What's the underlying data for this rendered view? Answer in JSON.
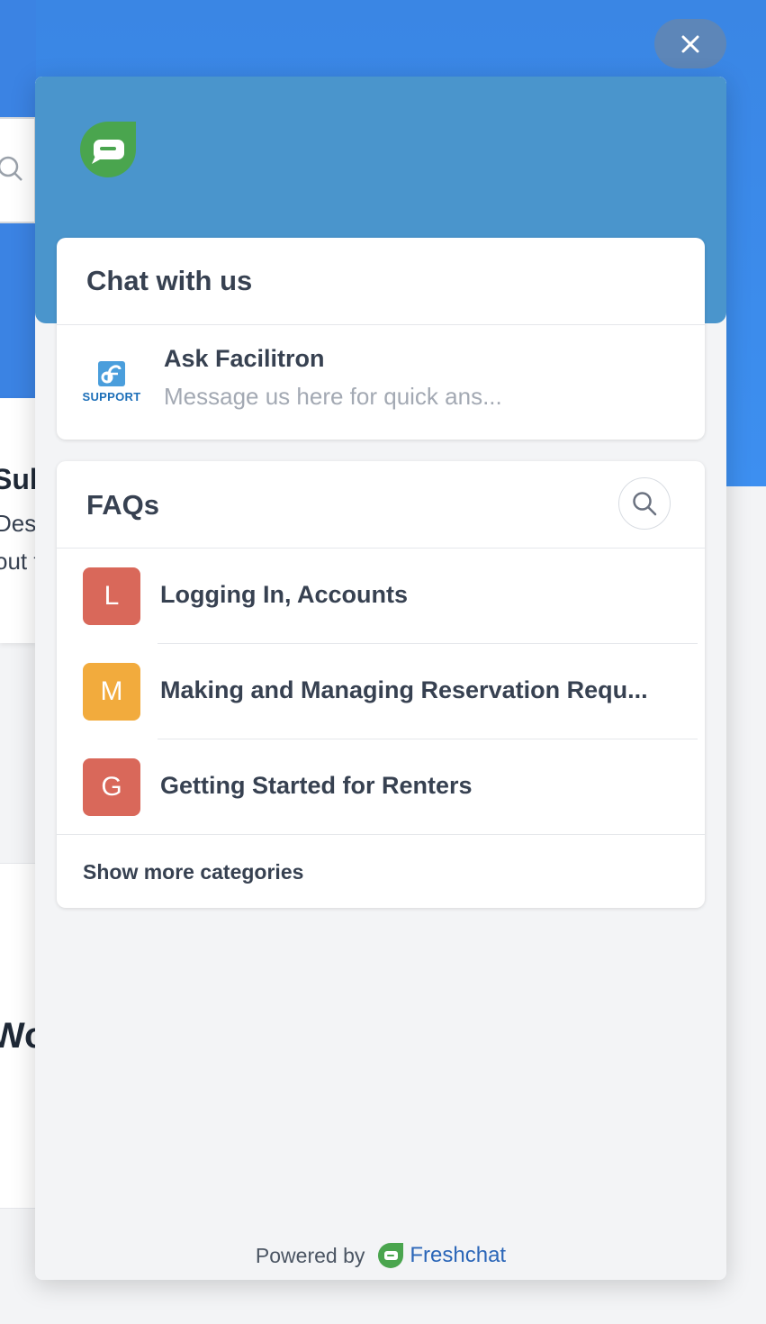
{
  "background": {
    "card_title": "Sub",
    "card_line1": "Desc",
    "card_line2": "out t",
    "card2_title": "Wo"
  },
  "widget": {
    "chat_section": {
      "title": "Chat with us",
      "channel": {
        "name": "Ask Facilitron",
        "description": "Message us here for quick ans...",
        "logo_text": "SUPPORT"
      }
    },
    "faq_section": {
      "title": "FAQs",
      "categories": [
        {
          "initial": "L",
          "label": "Logging In, Accounts",
          "color": "#d9685a"
        },
        {
          "initial": "M",
          "label": "Making and Managing Reservation Requ...",
          "color": "#f2ab3d"
        },
        {
          "initial": "G",
          "label": "Getting Started for Renters",
          "color": "#d9685a"
        }
      ],
      "show_more": "Show more categories"
    },
    "footer": {
      "powered_by": "Powered by",
      "brand": "Freshchat"
    }
  },
  "colors": {
    "header": "#4a95cc",
    "hero": "#3d8ff0",
    "brand_green": "#4aa54e",
    "close_bg": "#5d86b8"
  },
  "icons": [
    "close-icon",
    "chat-bubble-icon",
    "search-icon",
    "facilitron-logo"
  ]
}
